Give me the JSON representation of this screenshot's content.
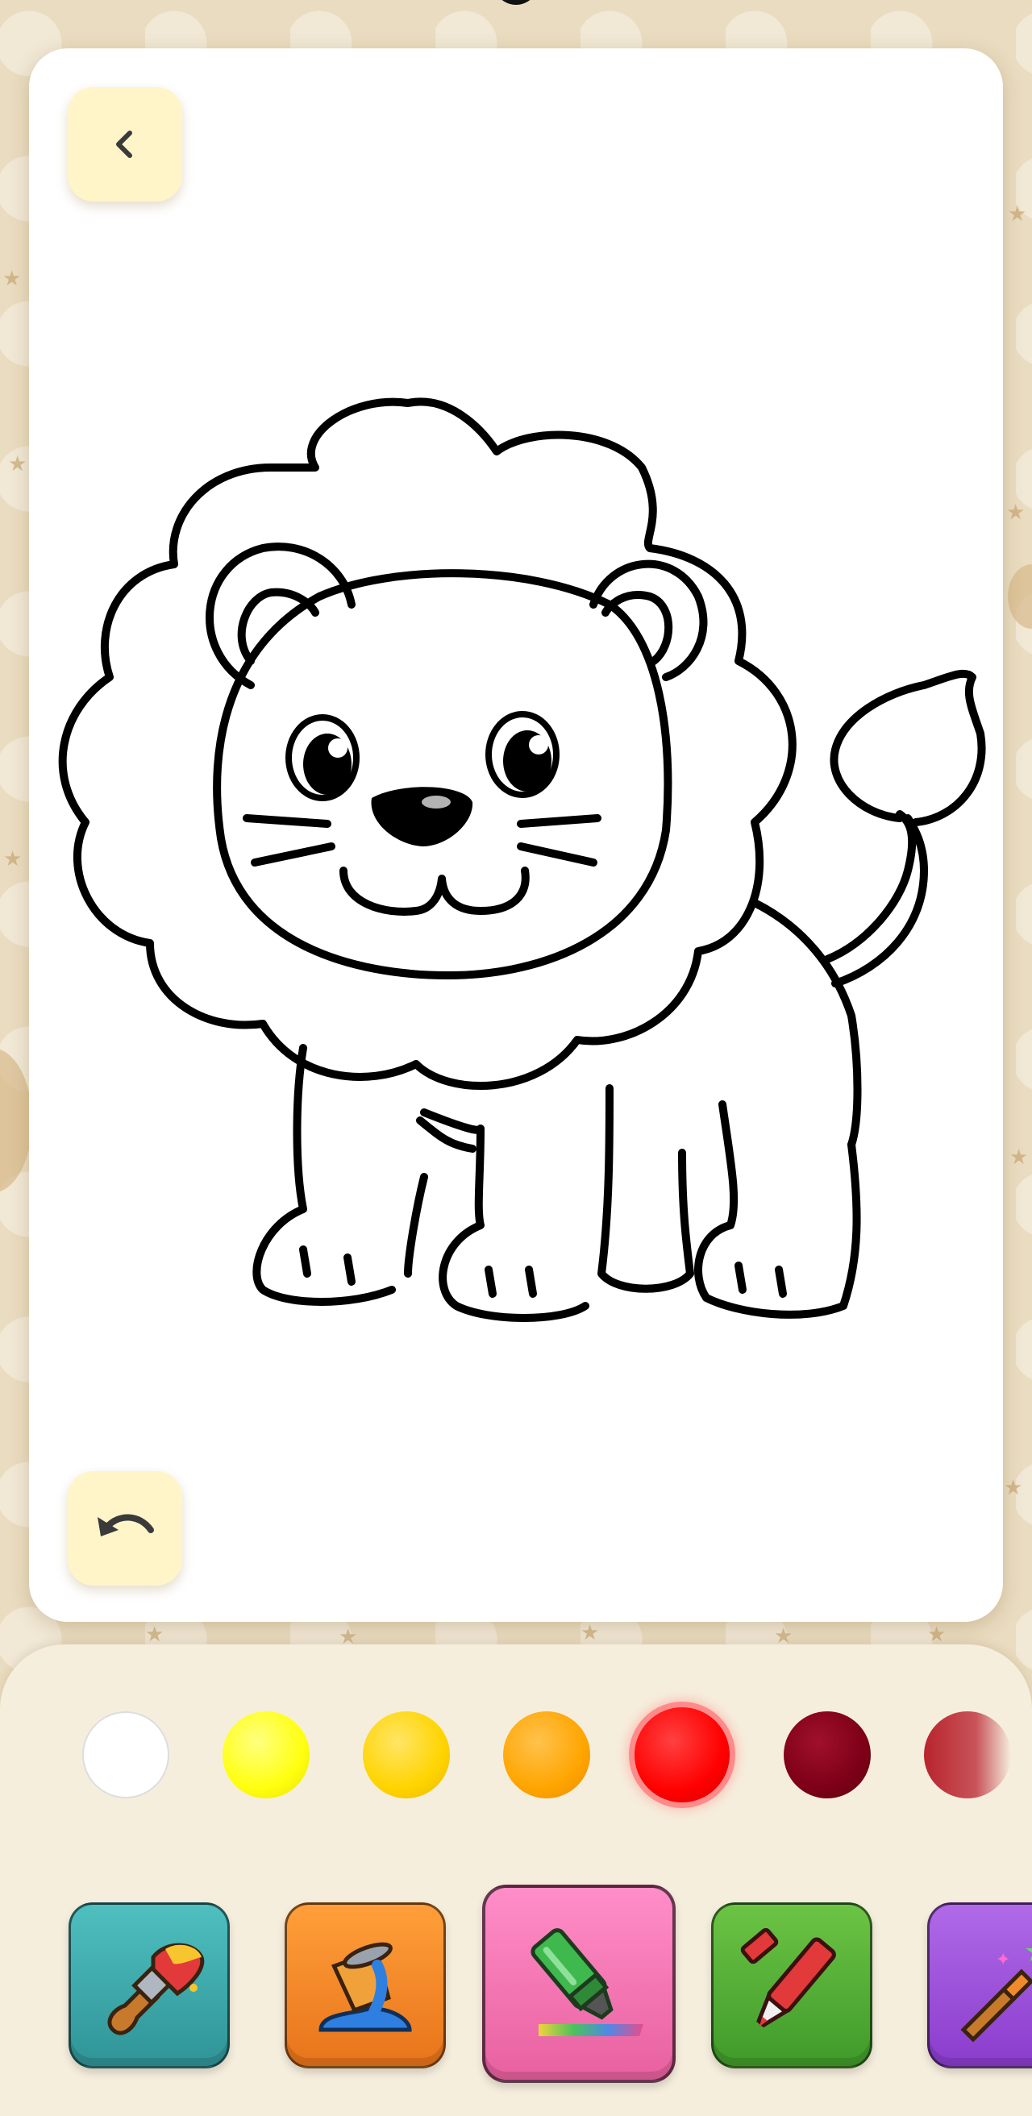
{
  "app": {
    "back_icon": "chevron-left-icon",
    "undo_icon": "undo-icon",
    "drawing": "lion coloring outline"
  },
  "palette": {
    "colors": [
      "#ffffff",
      "#ffff10",
      "#ffd400",
      "#ffa500",
      "#ff0000",
      "#7d0018",
      "#b8242c"
    ],
    "selected_index": 4
  },
  "tools": [
    {
      "name": "paint-brush",
      "icon": "paint-brush-icon",
      "color": "#3ea7a8"
    },
    {
      "name": "paint-bucket",
      "icon": "paint-bucket-icon",
      "color": "#f58a1c"
    },
    {
      "name": "highlighter",
      "icon": "highlighter-icon",
      "color": "#f27cb8",
      "active": true
    },
    {
      "name": "marker",
      "icon": "marker-icon",
      "color": "#5cae3a"
    },
    {
      "name": "magic-wand",
      "icon": "magic-brush-icon",
      "color": "#9b4fd6"
    }
  ]
}
